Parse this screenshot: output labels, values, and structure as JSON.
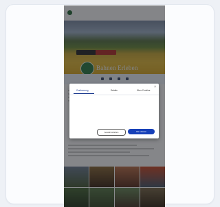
{
  "site": {
    "logo_text": "",
    "nav": [],
    "hero_title": "Bahnen Erleben",
    "hero_subtitle": "",
    "toolbar_items": [
      {
        "label": "",
        "icon": "calendar-icon"
      },
      {
        "label": "",
        "icon": "ticket-icon"
      },
      {
        "label": "",
        "icon": "map-icon"
      },
      {
        "label": "",
        "icon": "info-icon"
      }
    ]
  },
  "consent_dialog": {
    "tabs": [
      "Zustimmung",
      "Details",
      "Über Cookies"
    ],
    "active_tab": "Zustimmung",
    "close_label": "×",
    "heading": "",
    "body": "",
    "settings_button": "Auswahl erlauben",
    "accept_button": "Alle zulassen"
  },
  "colors": {
    "accent": "#1740b8",
    "overlay": "#14161c",
    "card_background": "#fbfcfe"
  }
}
